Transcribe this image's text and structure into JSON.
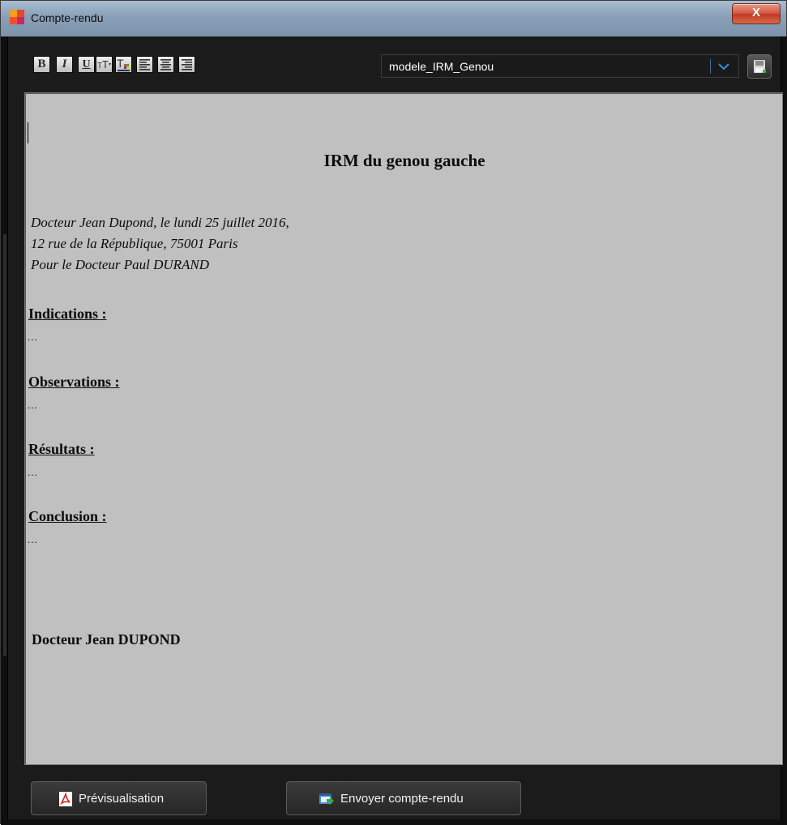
{
  "window": {
    "title": "Compte-rendu",
    "close_label": "X"
  },
  "toolbar": {
    "buttons": [
      {
        "name": "bold-button",
        "label": "B"
      },
      {
        "name": "italic-button",
        "label": "I"
      },
      {
        "name": "underline-button",
        "label": "U"
      },
      {
        "name": "font-size-button",
        "icon": "font-size-icon"
      },
      {
        "name": "font-color-button",
        "icon": "font-color-icon"
      },
      {
        "name": "align-left-button",
        "icon": "align-left-icon"
      },
      {
        "name": "align-center-button",
        "icon": "align-center-icon"
      },
      {
        "name": "align-right-button",
        "icon": "align-right-icon"
      }
    ],
    "template_select": {
      "value": "modele_IRM_Genou"
    },
    "save_icon": "floppy-save-icon"
  },
  "document": {
    "title": "IRM du genou gauche",
    "header_lines": [
      "Docteur Jean Dupond, le lundi 25 juillet 2016,",
      "12 rue de la République, 75001 Paris",
      "Pour le Docteur Paul DURAND"
    ],
    "sections": [
      {
        "label": "Indications :",
        "text": "..."
      },
      {
        "label": "Observations :",
        "text": "..."
      },
      {
        "label": "Résultats :",
        "text": "..."
      },
      {
        "label": "Conclusion :",
        "text": "..."
      }
    ],
    "signature": "Docteur Jean DUPOND"
  },
  "footer": {
    "preview_label": "Prévisualisation",
    "preview_icon": "pdf-icon",
    "send_label": "Envoyer compte-rendu",
    "send_icon": "send-report-icon"
  },
  "colors": {
    "window_bg": "#1b1b1b",
    "editor_bg": "#c0c0c0",
    "accent": "#3a6ea5",
    "close_red": "#c8452c"
  }
}
